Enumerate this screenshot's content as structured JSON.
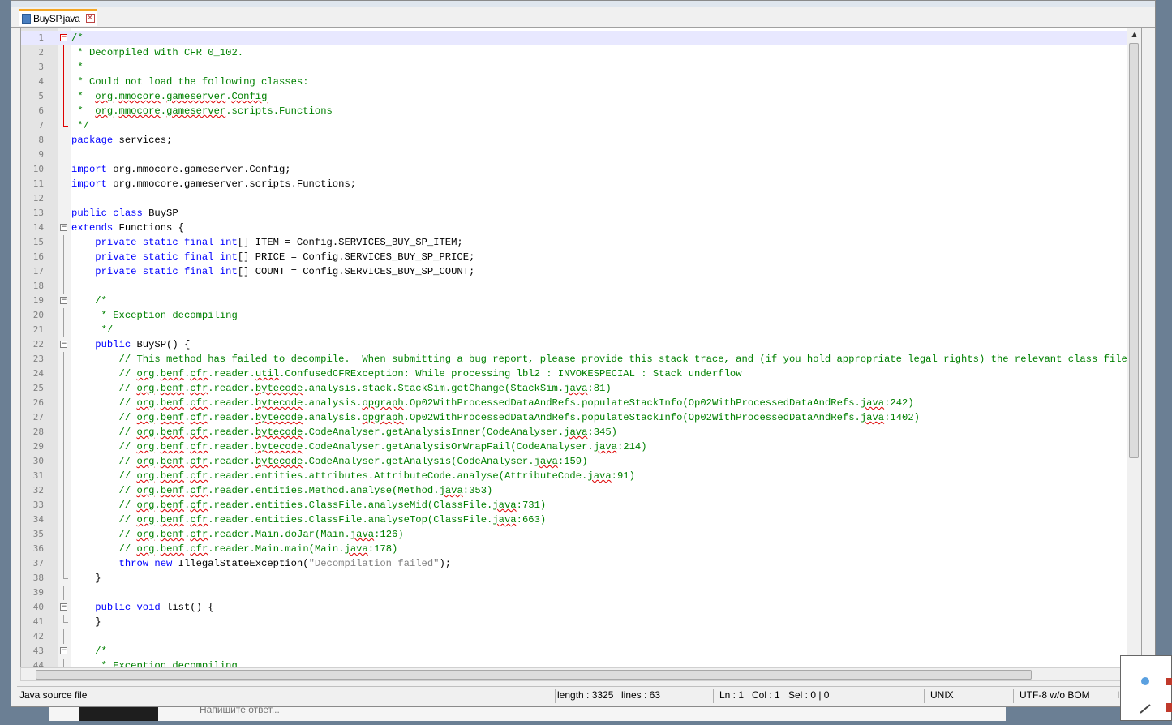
{
  "tab": {
    "label": "BuySP.java",
    "close_glyph": "✕"
  },
  "lines": [
    {
      "n": "1",
      "fold": "minus-red",
      "foldline": "",
      "cur": true,
      "tokens": [
        [
          "c",
          "/*"
        ]
      ]
    },
    {
      "n": "2",
      "fold": "",
      "foldline": "red",
      "tokens": [
        [
          "c",
          " * Decompiled with CFR 0_102."
        ]
      ]
    },
    {
      "n": "3",
      "fold": "",
      "foldline": "red",
      "tokens": [
        [
          "c",
          " *"
        ]
      ]
    },
    {
      "n": "4",
      "fold": "",
      "foldline": "red",
      "tokens": [
        [
          "c",
          " * Could not load the following classes:"
        ]
      ]
    },
    {
      "n": "5",
      "fold": "",
      "foldline": "red",
      "tokens": [
        [
          "c",
          " *  "
        ],
        [
          "cq",
          "org"
        ],
        [
          "c",
          "."
        ],
        [
          "cq",
          "mmocore"
        ],
        [
          "c",
          "."
        ],
        [
          "cq",
          "gameserver"
        ],
        [
          "c",
          "."
        ],
        [
          "cq",
          "Config"
        ]
      ]
    },
    {
      "n": "6",
      "fold": "",
      "foldline": "red",
      "tokens": [
        [
          "c",
          " *  "
        ],
        [
          "cq",
          "org"
        ],
        [
          "c",
          "."
        ],
        [
          "cq",
          "mmocore"
        ],
        [
          "c",
          "."
        ],
        [
          "cq",
          "gameserver"
        ],
        [
          "c",
          ".scripts.Functions"
        ]
      ]
    },
    {
      "n": "7",
      "fold": "",
      "foldline": "red-end",
      "tokens": [
        [
          "c",
          " */"
        ]
      ]
    },
    {
      "n": "8",
      "fold": "",
      "foldline": "",
      "tokens": [
        [
          "k",
          "package"
        ],
        [
          "t",
          " services;"
        ]
      ]
    },
    {
      "n": "9",
      "fold": "",
      "foldline": "",
      "tokens": []
    },
    {
      "n": "10",
      "fold": "",
      "foldline": "",
      "tokens": [
        [
          "k",
          "import"
        ],
        [
          "t",
          " org.mmocore.gameserver.Config;"
        ]
      ]
    },
    {
      "n": "11",
      "fold": "",
      "foldline": "",
      "tokens": [
        [
          "k",
          "import"
        ],
        [
          "t",
          " org.mmocore.gameserver.scripts.Functions;"
        ]
      ]
    },
    {
      "n": "12",
      "fold": "",
      "foldline": "",
      "tokens": []
    },
    {
      "n": "13",
      "fold": "",
      "foldline": "",
      "tokens": [
        [
          "k",
          "public class"
        ],
        [
          "t",
          " BuySP"
        ]
      ]
    },
    {
      "n": "14",
      "fold": "minus",
      "foldline": "",
      "tokens": [
        [
          "k",
          "extends"
        ],
        [
          "t",
          " Functions {"
        ]
      ]
    },
    {
      "n": "15",
      "fold": "",
      "foldline": "grey",
      "tokens": [
        [
          "t",
          "    "
        ],
        [
          "k",
          "private static final int"
        ],
        [
          "t",
          "[] ITEM = Config.SERVICES_BUY_SP_ITEM;"
        ]
      ]
    },
    {
      "n": "16",
      "fold": "",
      "foldline": "grey",
      "tokens": [
        [
          "t",
          "    "
        ],
        [
          "k",
          "private static final int"
        ],
        [
          "t",
          "[] PRICE = Config.SERVICES_BUY_SP_PRICE;"
        ]
      ]
    },
    {
      "n": "17",
      "fold": "",
      "foldline": "grey",
      "tokens": [
        [
          "t",
          "    "
        ],
        [
          "k",
          "private static final int"
        ],
        [
          "t",
          "[] COUNT = Config.SERVICES_BUY_SP_COUNT;"
        ]
      ]
    },
    {
      "n": "18",
      "fold": "",
      "foldline": "grey",
      "tokens": []
    },
    {
      "n": "19",
      "fold": "minus",
      "foldline": "",
      "tokens": [
        [
          "t",
          "    "
        ],
        [
          "c",
          "/*"
        ]
      ]
    },
    {
      "n": "20",
      "fold": "",
      "foldline": "grey",
      "tokens": [
        [
          "t",
          "    "
        ],
        [
          "c",
          " * Exception decompiling"
        ]
      ]
    },
    {
      "n": "21",
      "fold": "",
      "foldline": "grey",
      "tokens": [
        [
          "t",
          "    "
        ],
        [
          "c",
          " */"
        ]
      ]
    },
    {
      "n": "22",
      "fold": "minus",
      "foldline": "",
      "tokens": [
        [
          "t",
          "    "
        ],
        [
          "k",
          "public"
        ],
        [
          "t",
          " BuySP() {"
        ]
      ]
    },
    {
      "n": "23",
      "fold": "",
      "foldline": "grey",
      "tokens": [
        [
          "t",
          "        "
        ],
        [
          "c",
          "// This method has failed to decompile.  When submitting a bug report, please provide this stack trace, and (if you hold appropriate legal rights) the relevant class file."
        ]
      ]
    },
    {
      "n": "24",
      "fold": "",
      "foldline": "grey",
      "tokens": [
        [
          "t",
          "        "
        ],
        [
          "c",
          "// "
        ],
        [
          "cq",
          "org"
        ],
        [
          "c",
          "."
        ],
        [
          "cq",
          "benf"
        ],
        [
          "c",
          "."
        ],
        [
          "cq",
          "cfr"
        ],
        [
          "c",
          ".reader."
        ],
        [
          "cq",
          "util"
        ],
        [
          "c",
          ".ConfusedCFRException: While processing lbl2 : INVOKESPECIAL : Stack underflow"
        ]
      ]
    },
    {
      "n": "25",
      "fold": "",
      "foldline": "grey",
      "tokens": [
        [
          "t",
          "        "
        ],
        [
          "c",
          "// "
        ],
        [
          "cq",
          "org"
        ],
        [
          "c",
          "."
        ],
        [
          "cq",
          "benf"
        ],
        [
          "c",
          "."
        ],
        [
          "cq",
          "cfr"
        ],
        [
          "c",
          ".reader."
        ],
        [
          "cq",
          "bytecode"
        ],
        [
          "c",
          ".analysis.stack.StackSim.getChange(StackSim."
        ],
        [
          "cq",
          "java"
        ],
        [
          "c",
          ":81)"
        ]
      ]
    },
    {
      "n": "26",
      "fold": "",
      "foldline": "grey",
      "tokens": [
        [
          "t",
          "        "
        ],
        [
          "c",
          "// "
        ],
        [
          "cq",
          "org"
        ],
        [
          "c",
          "."
        ],
        [
          "cq",
          "benf"
        ],
        [
          "c",
          "."
        ],
        [
          "cq",
          "cfr"
        ],
        [
          "c",
          ".reader."
        ],
        [
          "cq",
          "bytecode"
        ],
        [
          "c",
          ".analysis."
        ],
        [
          "cq",
          "opgraph"
        ],
        [
          "c",
          ".Op02WithProcessedDataAndRefs.populateStackInfo(Op02WithProcessedDataAndRefs."
        ],
        [
          "cq",
          "java"
        ],
        [
          "c",
          ":242)"
        ]
      ]
    },
    {
      "n": "27",
      "fold": "",
      "foldline": "grey",
      "tokens": [
        [
          "t",
          "        "
        ],
        [
          "c",
          "// "
        ],
        [
          "cq",
          "org"
        ],
        [
          "c",
          "."
        ],
        [
          "cq",
          "benf"
        ],
        [
          "c",
          "."
        ],
        [
          "cq",
          "cfr"
        ],
        [
          "c",
          ".reader."
        ],
        [
          "cq",
          "bytecode"
        ],
        [
          "c",
          ".analysis."
        ],
        [
          "cq",
          "opgraph"
        ],
        [
          "c",
          ".Op02WithProcessedDataAndRefs.populateStackInfo(Op02WithProcessedDataAndRefs."
        ],
        [
          "cq",
          "java"
        ],
        [
          "c",
          ":1402)"
        ]
      ]
    },
    {
      "n": "28",
      "fold": "",
      "foldline": "grey",
      "tokens": [
        [
          "t",
          "        "
        ],
        [
          "c",
          "// "
        ],
        [
          "cq",
          "org"
        ],
        [
          "c",
          "."
        ],
        [
          "cq",
          "benf"
        ],
        [
          "c",
          "."
        ],
        [
          "cq",
          "cfr"
        ],
        [
          "c",
          ".reader."
        ],
        [
          "cq",
          "bytecode"
        ],
        [
          "c",
          ".CodeAnalyser.getAnalysisInner(CodeAnalyser."
        ],
        [
          "cq",
          "java"
        ],
        [
          "c",
          ":345)"
        ]
      ]
    },
    {
      "n": "29",
      "fold": "",
      "foldline": "grey",
      "tokens": [
        [
          "t",
          "        "
        ],
        [
          "c",
          "// "
        ],
        [
          "cq",
          "org"
        ],
        [
          "c",
          "."
        ],
        [
          "cq",
          "benf"
        ],
        [
          "c",
          "."
        ],
        [
          "cq",
          "cfr"
        ],
        [
          "c",
          ".reader."
        ],
        [
          "cq",
          "bytecode"
        ],
        [
          "c",
          ".CodeAnalyser.getAnalysisOrWrapFail(CodeAnalyser."
        ],
        [
          "cq",
          "java"
        ],
        [
          "c",
          ":214)"
        ]
      ]
    },
    {
      "n": "30",
      "fold": "",
      "foldline": "grey",
      "tokens": [
        [
          "t",
          "        "
        ],
        [
          "c",
          "// "
        ],
        [
          "cq",
          "org"
        ],
        [
          "c",
          "."
        ],
        [
          "cq",
          "benf"
        ],
        [
          "c",
          "."
        ],
        [
          "cq",
          "cfr"
        ],
        [
          "c",
          ".reader."
        ],
        [
          "cq",
          "bytecode"
        ],
        [
          "c",
          ".CodeAnalyser.getAnalysis(CodeAnalyser."
        ],
        [
          "cq",
          "java"
        ],
        [
          "c",
          ":159)"
        ]
      ]
    },
    {
      "n": "31",
      "fold": "",
      "foldline": "grey",
      "tokens": [
        [
          "t",
          "        "
        ],
        [
          "c",
          "// "
        ],
        [
          "cq",
          "org"
        ],
        [
          "c",
          "."
        ],
        [
          "cq",
          "benf"
        ],
        [
          "c",
          "."
        ],
        [
          "cq",
          "cfr"
        ],
        [
          "c",
          ".reader.entities.attributes.AttributeCode.analyse(AttributeCode."
        ],
        [
          "cq",
          "java"
        ],
        [
          "c",
          ":91)"
        ]
      ]
    },
    {
      "n": "32",
      "fold": "",
      "foldline": "grey",
      "tokens": [
        [
          "t",
          "        "
        ],
        [
          "c",
          "// "
        ],
        [
          "cq",
          "org"
        ],
        [
          "c",
          "."
        ],
        [
          "cq",
          "benf"
        ],
        [
          "c",
          "."
        ],
        [
          "cq",
          "cfr"
        ],
        [
          "c",
          ".reader.entities.Method.analyse(Method."
        ],
        [
          "cq",
          "java"
        ],
        [
          "c",
          ":353)"
        ]
      ]
    },
    {
      "n": "33",
      "fold": "",
      "foldline": "grey",
      "tokens": [
        [
          "t",
          "        "
        ],
        [
          "c",
          "// "
        ],
        [
          "cq",
          "org"
        ],
        [
          "c",
          "."
        ],
        [
          "cq",
          "benf"
        ],
        [
          "c",
          "."
        ],
        [
          "cq",
          "cfr"
        ],
        [
          "c",
          ".reader.entities.ClassFile.analyseMid(ClassFile."
        ],
        [
          "cq",
          "java"
        ],
        [
          "c",
          ":731)"
        ]
      ]
    },
    {
      "n": "34",
      "fold": "",
      "foldline": "grey",
      "tokens": [
        [
          "t",
          "        "
        ],
        [
          "c",
          "// "
        ],
        [
          "cq",
          "org"
        ],
        [
          "c",
          "."
        ],
        [
          "cq",
          "benf"
        ],
        [
          "c",
          "."
        ],
        [
          "cq",
          "cfr"
        ],
        [
          "c",
          ".reader.entities.ClassFile.analyseTop(ClassFile."
        ],
        [
          "cq",
          "java"
        ],
        [
          "c",
          ":663)"
        ]
      ]
    },
    {
      "n": "35",
      "fold": "",
      "foldline": "grey",
      "tokens": [
        [
          "t",
          "        "
        ],
        [
          "c",
          "// "
        ],
        [
          "cq",
          "org"
        ],
        [
          "c",
          "."
        ],
        [
          "cq",
          "benf"
        ],
        [
          "c",
          "."
        ],
        [
          "cq",
          "cfr"
        ],
        [
          "c",
          ".reader.Main.doJar(Main."
        ],
        [
          "cq",
          "java"
        ],
        [
          "c",
          ":126)"
        ]
      ]
    },
    {
      "n": "36",
      "fold": "",
      "foldline": "grey",
      "tokens": [
        [
          "t",
          "        "
        ],
        [
          "c",
          "// "
        ],
        [
          "cq",
          "org"
        ],
        [
          "c",
          "."
        ],
        [
          "cq",
          "benf"
        ],
        [
          "c",
          "."
        ],
        [
          "cq",
          "cfr"
        ],
        [
          "c",
          ".reader.Main.main(Main."
        ],
        [
          "cq",
          "java"
        ],
        [
          "c",
          ":178)"
        ]
      ]
    },
    {
      "n": "37",
      "fold": "",
      "foldline": "grey",
      "tokens": [
        [
          "t",
          "        "
        ],
        [
          "k",
          "throw new"
        ],
        [
          "t",
          " IllegalStateException("
        ],
        [
          "s",
          "\"Decompilation failed\""
        ],
        [
          "t",
          ");"
        ]
      ]
    },
    {
      "n": "38",
      "fold": "",
      "foldline": "grey-end",
      "tokens": [
        [
          "t",
          "    }"
        ]
      ]
    },
    {
      "n": "39",
      "fold": "",
      "foldline": "grey",
      "tokens": []
    },
    {
      "n": "40",
      "fold": "minus",
      "foldline": "",
      "tokens": [
        [
          "t",
          "    "
        ],
        [
          "k",
          "public void"
        ],
        [
          "t",
          " list() {"
        ]
      ]
    },
    {
      "n": "41",
      "fold": "",
      "foldline": "grey-end",
      "tokens": [
        [
          "t",
          "    }"
        ]
      ]
    },
    {
      "n": "42",
      "fold": "",
      "foldline": "grey",
      "tokens": []
    },
    {
      "n": "43",
      "fold": "minus",
      "foldline": "",
      "tokens": [
        [
          "t",
          "    "
        ],
        [
          "c",
          "/*"
        ]
      ]
    },
    {
      "n": "44",
      "fold": "",
      "foldline": "grey",
      "tokens": [
        [
          "t",
          "    "
        ],
        [
          "c",
          " * Exception decompiling"
        ]
      ]
    }
  ],
  "status": {
    "file_type": "Java source file",
    "length": "length : 3325",
    "lines": "lines : 63",
    "ln": "Ln : 1",
    "col": "Col : 1",
    "sel": "Sel : 0 | 0",
    "eol": "UNIX",
    "encoding": "UTF-8 w/o BOM",
    "mode": "IN"
  },
  "background": {
    "reply_placeholder": "Напишите ответ..."
  },
  "colors": {
    "comment": "#008000",
    "keyword": "#0000ff",
    "string": "#808080",
    "tab_accent": "#f5a623"
  }
}
